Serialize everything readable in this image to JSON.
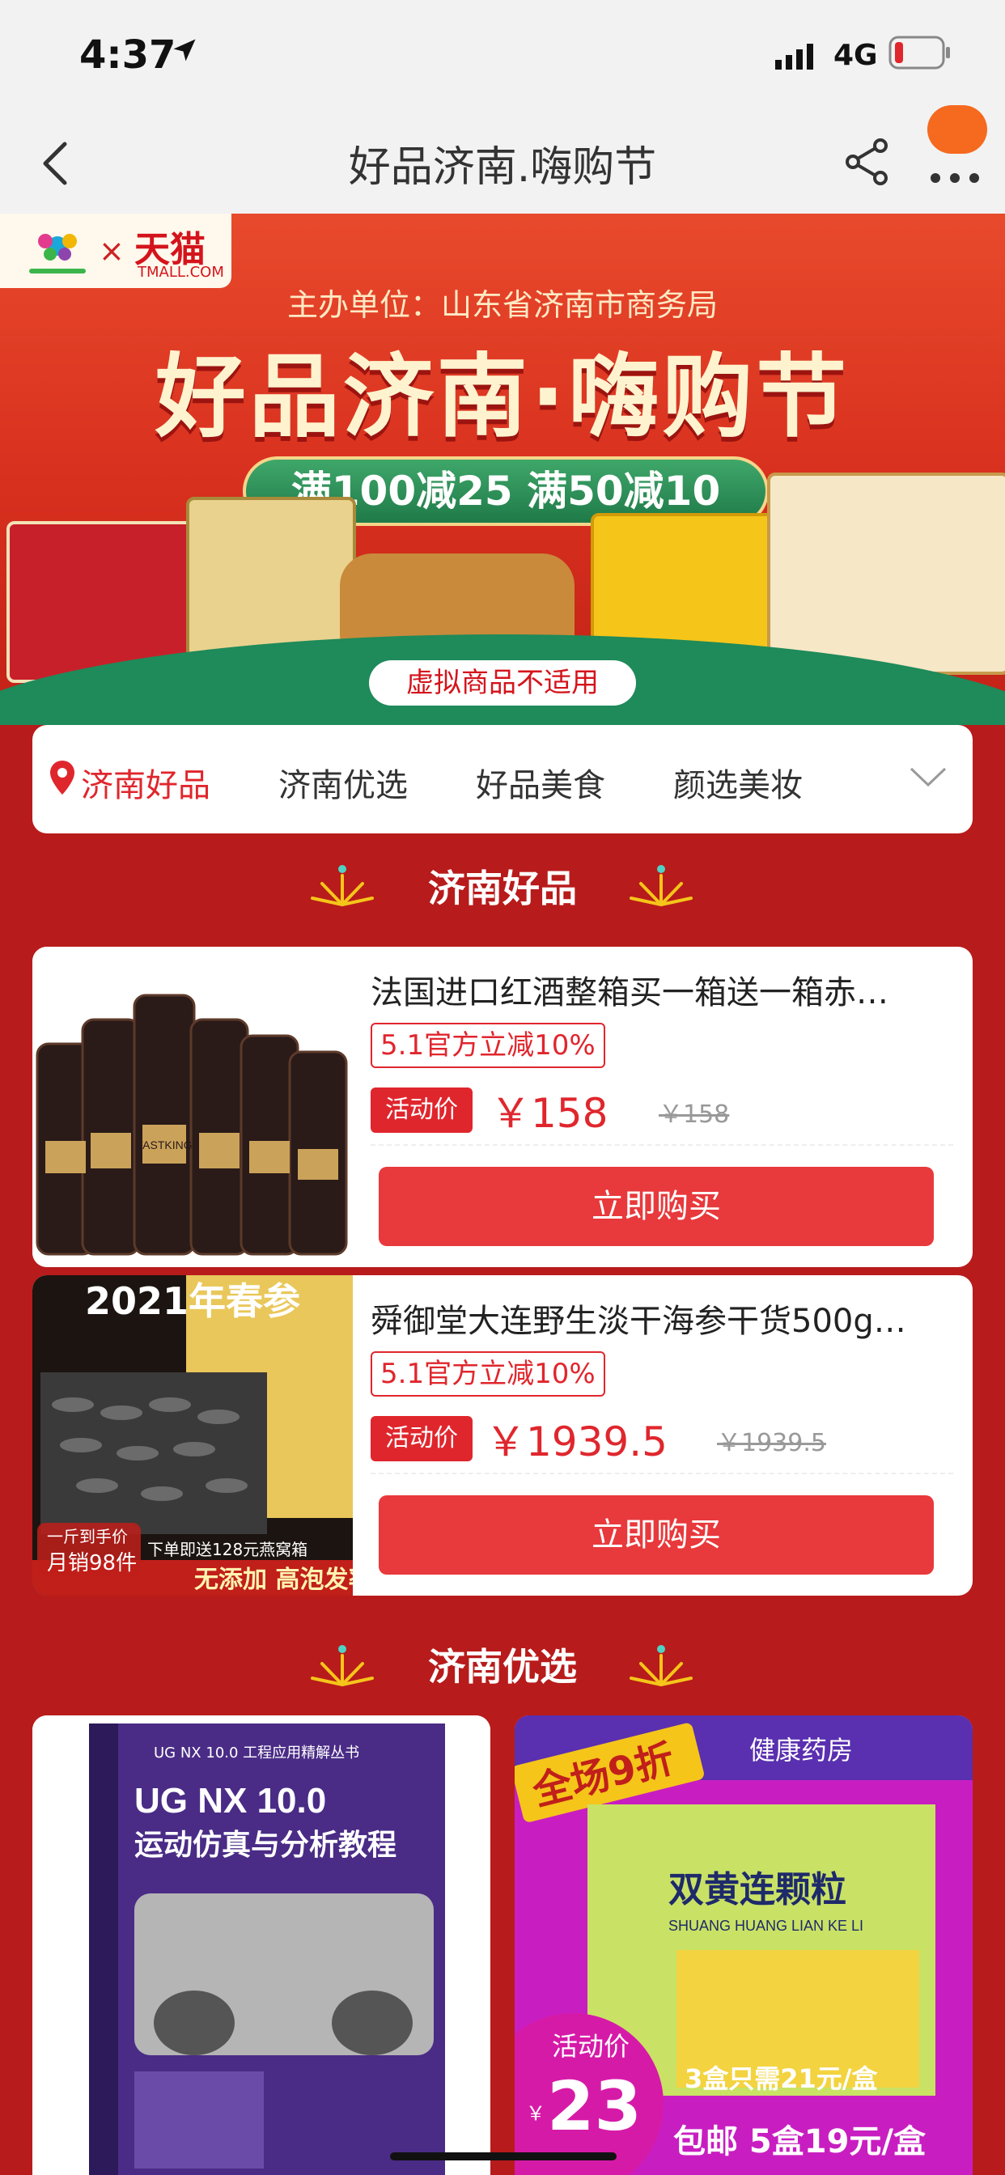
{
  "status_bar": {
    "time": "4:37",
    "network": "4G"
  },
  "nav": {
    "title": "好品济南.嗨购节"
  },
  "banner": {
    "logo_brand": "天猫",
    "logo_sub": "TMALL.COM",
    "logo_x": "×",
    "sponsor": "主办单位：山东省济南市商务局",
    "headline": "好品济南·嗨购节",
    "offer": "满100减25  满50减10",
    "note": "虚拟商品不适用"
  },
  "tabs": [
    {
      "label": "济南好品",
      "active": true
    },
    {
      "label": "济南优选",
      "active": false
    },
    {
      "label": "好品美食",
      "active": false
    },
    {
      "label": "颜选美妆",
      "active": false
    }
  ],
  "sections": {
    "haopin_title": "济南好品",
    "youxuan_title": "济南优选"
  },
  "products": [
    {
      "title": "法国进口红酒整箱买一箱送一箱赤…",
      "tag": "5.1官方立减10%",
      "label": "活动价",
      "price": "￥158",
      "orig_price": "￥158",
      "buy": "立即购买",
      "image_text": "FASTKING"
    },
    {
      "title": "舜御堂大连野生淡干海参干货500g…",
      "tag": "5.1官方立减10%",
      "label": "活动价",
      "price": "￥1939.5",
      "orig_price": "￥1939.5",
      "buy": "立即购买",
      "image_text": "2021年春参",
      "image_caption_1": "一斤到手价",
      "image_caption_2": "月销98件",
      "image_caption_3": "下单即送128元燕窝箱",
      "image_caption_4": "无添加 高泡发率"
    }
  ],
  "grid_items": [
    {
      "line1": "UG NX 10.0",
      "line2": "运动仿真与分析教程",
      "series": "UG NX 10.0 工程应用精解丛书"
    },
    {
      "promo": "全场9折",
      "store": "健康药房",
      "name": "双黄连颗粒",
      "pinyin": "SHUANG HUANG LIAN KE LI",
      "label": "活动价",
      "price": "23",
      "deal1": "3盒只需21元/盒",
      "deal2": "包邮 5盒19元/盒"
    }
  ],
  "colors": {
    "accent": "#e0262d",
    "page_bg": "#b81b1b",
    "buy_button": "#e8393c"
  }
}
